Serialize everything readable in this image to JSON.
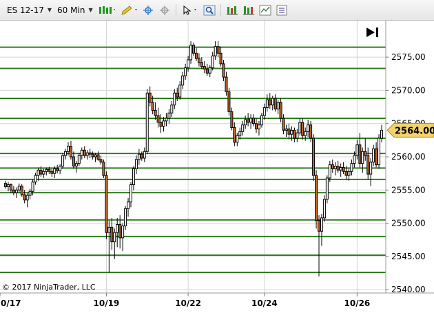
{
  "toolbar": {
    "instrument": "ES 12-17",
    "interval": "60 Min"
  },
  "chart_data": {
    "type": "candlestick",
    "instrument": "ES 12-17",
    "interval": "60 Min",
    "y_axis": {
      "ylim": [
        2539.5,
        2580.5
      ],
      "ticks": [
        "2575.00",
        "2570.00",
        "2565.00",
        "2560.00",
        "2555.00",
        "2550.00",
        "2545.00",
        "2540.00"
      ]
    },
    "x_axis": {
      "ticks": [
        "0/17",
        "10/19",
        "10/22",
        "10/24",
        "10/26"
      ]
    },
    "horizontal_levels": [
      2576.5,
      2573.3,
      2568.8,
      2565.8,
      2562.8,
      2560.5,
      2558.3,
      2556.6,
      2554.6,
      2550.5,
      2548.0,
      2545.2,
      2542.6
    ],
    "last_price": "2564.00",
    "copyright": "© 2017 NinjaTrader, LLC",
    "colors": {
      "up": "#ffffff",
      "down": "#c56a2a",
      "wick": "#000000",
      "level_line": "#2f7d1f",
      "grid": "#d4d4d4",
      "last_price_bg": "#f2d36b"
    },
    "ohlc": [
      [
        2556,
        2556.4,
        2555.2,
        2555.5
      ],
      [
        2555.5,
        2556.2,
        2554.8,
        2555.8
      ],
      [
        2555.8,
        2556,
        2554.5,
        2555
      ],
      [
        2555,
        2555.6,
        2554.2,
        2554.6
      ],
      [
        2554.6,
        2555.4,
        2553.8,
        2555
      ],
      [
        2555,
        2556,
        2554.6,
        2555.6
      ],
      [
        2555.6,
        2555.9,
        2554,
        2554.3
      ],
      [
        2554.3,
        2555,
        2553,
        2553.5
      ],
      [
        2553.5,
        2554.5,
        2552.4,
        2554.2
      ],
      [
        2554.2,
        2555.2,
        2553.6,
        2554.8
      ],
      [
        2554.8,
        2556.6,
        2554.2,
        2556.2
      ],
      [
        2556.2,
        2557.6,
        2555.8,
        2557.2
      ],
      [
        2557.2,
        2558.4,
        2556.4,
        2558
      ],
      [
        2558,
        2558.6,
        2557,
        2557.4
      ],
      [
        2557.4,
        2558.2,
        2556.8,
        2557.8
      ],
      [
        2557.8,
        2558.4,
        2557.2,
        2558.1
      ],
      [
        2558.1,
        2558.5,
        2557.4,
        2557.8
      ],
      [
        2557.8,
        2558.2,
        2557,
        2557.5
      ],
      [
        2557.5,
        2558.6,
        2556.8,
        2558.2
      ],
      [
        2558.2,
        2558.8,
        2557.5,
        2557.9
      ],
      [
        2557.9,
        2558.9,
        2557.4,
        2558.6
      ],
      [
        2558.6,
        2560.6,
        2558.2,
        2560.2
      ],
      [
        2560.2,
        2561.2,
        2559.6,
        2560.8
      ],
      [
        2560.8,
        2562.2,
        2560.2,
        2561.6
      ],
      [
        2561.6,
        2562.4,
        2559.6,
        2560
      ],
      [
        2560,
        2560.8,
        2558.2,
        2558.6
      ],
      [
        2558.6,
        2559.4,
        2557.6,
        2559
      ],
      [
        2559,
        2560.6,
        2558.6,
        2560.2
      ],
      [
        2560.2,
        2561.4,
        2559.6,
        2561
      ],
      [
        2561,
        2561.6,
        2559.8,
        2560.2
      ],
      [
        2560.2,
        2561,
        2559.6,
        2560.6
      ],
      [
        2560.6,
        2561.2,
        2559.8,
        2560.4
      ],
      [
        2560.4,
        2560.8,
        2559.6,
        2560
      ],
      [
        2560,
        2560.6,
        2559.2,
        2560.3
      ],
      [
        2560.3,
        2560.8,
        2559.4,
        2559.6
      ],
      [
        2559.6,
        2560.2,
        2558.8,
        2559.2
      ],
      [
        2559.2,
        2559.6,
        2556.8,
        2557.2
      ],
      [
        2557.2,
        2557.8,
        2547.6,
        2548.6
      ],
      [
        2548.6,
        2550.4,
        2542.6,
        2549.4
      ],
      [
        2549.4,
        2550.8,
        2546,
        2547.2
      ],
      [
        2547.2,
        2549.2,
        2544.6,
        2548.6
      ],
      [
        2548.6,
        2550.8,
        2546.4,
        2549.8
      ],
      [
        2549.8,
        2551.2,
        2546.2,
        2547.8
      ],
      [
        2547.8,
        2550,
        2545.8,
        2549.6
      ],
      [
        2549.6,
        2552.6,
        2549,
        2552.2
      ],
      [
        2552.2,
        2553.8,
        2551,
        2553.2
      ],
      [
        2553.2,
        2556.2,
        2552.4,
        2555.8
      ],
      [
        2555.8,
        2558.6,
        2555,
        2558.2
      ],
      [
        2558.2,
        2560.2,
        2557.4,
        2559.6
      ],
      [
        2559.6,
        2561.2,
        2558.8,
        2560.4
      ],
      [
        2560.4,
        2560.8,
        2559.4,
        2559.8
      ],
      [
        2559.8,
        2561.4,
        2559.2,
        2560.8
      ],
      [
        2560.8,
        2570.2,
        2560.4,
        2569.6
      ],
      [
        2569.6,
        2570.6,
        2567.6,
        2568.2
      ],
      [
        2568.2,
        2569.2,
        2566.4,
        2567
      ],
      [
        2567,
        2568.2,
        2565.6,
        2566.2
      ],
      [
        2566.2,
        2567.4,
        2564.4,
        2565.2
      ],
      [
        2565.2,
        2566.4,
        2563.6,
        2564.6
      ],
      [
        2564.6,
        2566,
        2563.8,
        2565.4
      ],
      [
        2565.4,
        2566.6,
        2564.6,
        2565.8
      ],
      [
        2565.8,
        2567.2,
        2565,
        2566.6
      ],
      [
        2566.6,
        2568.4,
        2566,
        2567.8
      ],
      [
        2567.8,
        2570.2,
        2567.2,
        2569.6
      ],
      [
        2569.6,
        2570.4,
        2568.4,
        2569
      ],
      [
        2569,
        2571.4,
        2568.6,
        2570.8
      ],
      [
        2570.8,
        2572.8,
        2570.2,
        2572.2
      ],
      [
        2572.2,
        2574,
        2571.6,
        2573.4
      ],
      [
        2573.4,
        2575.2,
        2572.8,
        2574.6
      ],
      [
        2574.6,
        2577.4,
        2574,
        2576.8
      ],
      [
        2576.8,
        2577.2,
        2575.2,
        2575.6
      ],
      [
        2575.6,
        2576.4,
        2574.4,
        2574.8
      ],
      [
        2574.8,
        2575.6,
        2573.6,
        2574.2
      ],
      [
        2574.2,
        2575,
        2573.2,
        2573.6
      ],
      [
        2573.6,
        2574.4,
        2572.6,
        2573.2
      ],
      [
        2573.2,
        2574,
        2572.2,
        2572.6
      ],
      [
        2572.6,
        2573.8,
        2572,
        2573.4
      ],
      [
        2573.4,
        2575.8,
        2573,
        2575.2
      ],
      [
        2575.2,
        2577.4,
        2574.6,
        2576.6
      ],
      [
        2576.6,
        2577.4,
        2575,
        2575.6
      ],
      [
        2575.6,
        2576.6,
        2573.6,
        2574
      ],
      [
        2574,
        2574.6,
        2571.4,
        2572
      ],
      [
        2572,
        2572.8,
        2569.2,
        2569.8
      ],
      [
        2569.8,
        2570.4,
        2566.2,
        2566.8
      ],
      [
        2566.8,
        2567.4,
        2564,
        2564.4
      ],
      [
        2564.4,
        2565.2,
        2561.6,
        2562.2
      ],
      [
        2562.2,
        2563.6,
        2561.6,
        2563.2
      ],
      [
        2563.2,
        2564.4,
        2562.6,
        2563.8
      ],
      [
        2563.8,
        2565.4,
        2563.2,
        2564.8
      ],
      [
        2564.8,
        2566.2,
        2564.2,
        2565.6
      ],
      [
        2565.6,
        2566.6,
        2564.6,
        2565.2
      ],
      [
        2565.2,
        2566.4,
        2564.2,
        2565.8
      ],
      [
        2565.8,
        2566.4,
        2564.6,
        2565
      ],
      [
        2565,
        2565.8,
        2563.6,
        2564.2
      ],
      [
        2564.2,
        2565.4,
        2563.2,
        2564.8
      ],
      [
        2564.8,
        2566.6,
        2564.4,
        2566.2
      ],
      [
        2566.2,
        2568,
        2565.6,
        2567.4
      ],
      [
        2567.4,
        2569.4,
        2566.8,
        2568.6
      ],
      [
        2568.6,
        2569.6,
        2567.2,
        2567.8
      ],
      [
        2567.8,
        2569.2,
        2567,
        2568.8
      ],
      [
        2568.8,
        2569.4,
        2566.8,
        2567.2
      ],
      [
        2567.2,
        2568.6,
        2566.4,
        2568.2
      ],
      [
        2568.2,
        2568.8,
        2565.2,
        2565.8
      ],
      [
        2565.8,
        2566.4,
        2563.4,
        2564
      ],
      [
        2564,
        2564.8,
        2563,
        2564.2
      ],
      [
        2564.2,
        2565,
        2562.6,
        2563.4
      ],
      [
        2563.4,
        2564.6,
        2562.4,
        2564
      ],
      [
        2564,
        2564.4,
        2562.2,
        2562.8
      ],
      [
        2562.8,
        2564.2,
        2562.2,
        2563.6
      ],
      [
        2563.6,
        2565.8,
        2563.2,
        2565.2
      ],
      [
        2565.2,
        2565.8,
        2562.6,
        2563.2
      ],
      [
        2563.2,
        2564.4,
        2562.4,
        2563.8
      ],
      [
        2563.8,
        2565.6,
        2563,
        2564.8
      ],
      [
        2564.8,
        2565.4,
        2562.2,
        2562.8
      ],
      [
        2562.8,
        2563.4,
        2556.4,
        2557.2
      ],
      [
        2557.2,
        2558,
        2549.2,
        2550.4
      ],
      [
        2550.4,
        2551.2,
        2542,
        2548.8
      ],
      [
        2548.8,
        2551.4,
        2546.6,
        2550.8
      ],
      [
        2550.8,
        2554.2,
        2550.2,
        2553.6
      ],
      [
        2553.6,
        2557.2,
        2553,
        2556.8
      ],
      [
        2556.8,
        2559.4,
        2556.2,
        2558.8
      ],
      [
        2558.8,
        2559.6,
        2557.6,
        2558.2
      ],
      [
        2558.2,
        2559.2,
        2557.2,
        2558.6
      ],
      [
        2558.6,
        2559.4,
        2557.6,
        2558
      ],
      [
        2558,
        2559,
        2557,
        2558.4
      ],
      [
        2558.4,
        2559.2,
        2557.4,
        2557.8
      ],
      [
        2557.8,
        2558.6,
        2556.6,
        2557.2
      ],
      [
        2557.2,
        2558.2,
        2556.4,
        2557.8
      ],
      [
        2557.8,
        2559.6,
        2557.2,
        2559
      ],
      [
        2559,
        2560.8,
        2558.4,
        2560.2
      ],
      [
        2560.2,
        2562.6,
        2559.6,
        2561.8
      ],
      [
        2561.8,
        2563.6,
        2558.4,
        2559
      ],
      [
        2559,
        2561.4,
        2557.6,
        2560.8
      ],
      [
        2560.8,
        2562.8,
        2559.4,
        2560.2
      ],
      [
        2560.2,
        2561.4,
        2556.6,
        2557.4
      ],
      [
        2557.4,
        2559.8,
        2555.6,
        2559.2
      ],
      [
        2559.2,
        2561.8,
        2558.6,
        2561.2
      ],
      [
        2561.2,
        2562.2,
        2558.4,
        2558.8
      ],
      [
        2558.8,
        2563.4,
        2558.2,
        2562.8
      ],
      [
        2562.8,
        2564.8,
        2562.2,
        2564
      ]
    ]
  }
}
